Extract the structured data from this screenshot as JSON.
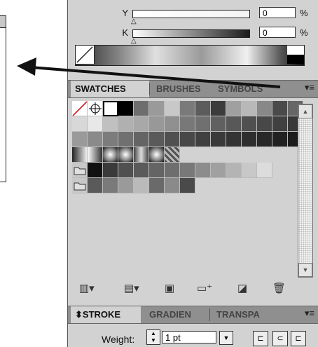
{
  "color_panel": {
    "y_label": "Y",
    "y_value": "0",
    "k_label": "K",
    "k_value": "0",
    "unit": "%"
  },
  "swatches_panel": {
    "tabs": [
      "SWATCHES",
      "BRUSHES",
      "SYMBOLS"
    ],
    "menu_icon": "panel-menu-icon"
  },
  "stroke_panel": {
    "tabs": [
      "STROKE",
      "GRADIEN",
      "TRANSPA"
    ],
    "stroke_prefix": "⬍",
    "weight_label": "Weight:",
    "weight_value": "1 pt"
  },
  "swatch_rows": [
    [
      "none",
      "registration",
      "white",
      "#000000",
      "#6e6e6e",
      "#9a9a9a",
      "#c8c8c8",
      "#7a7a7a",
      "#5c5c5c",
      "#3c3c3c",
      "#a0a0a0",
      "#b8b8b8",
      "#888888",
      "#4a4a4a",
      "#666666"
    ],
    [
      "#d8d8d8",
      "#e8e8e8",
      "#c0c0c0",
      "#b0b0b0",
      "#a8a8a8",
      "#989898",
      "#909090",
      "#787878",
      "#707070",
      "#606060",
      "#585858",
      "#505050",
      "#484848",
      "#404040",
      "#383838"
    ],
    [
      "#9a9a9a",
      "#8a8a8a",
      "#7c7c7c",
      "#707070",
      "#646464",
      "#5a5a5a",
      "#505050",
      "#484848",
      "#404040",
      "#3a3a3a",
      "#343434",
      "#2e2e2e",
      "#282828",
      "#222222",
      "#1c1c1c"
    ],
    [
      "grad-a",
      "grad-b",
      "radial",
      "radial",
      "grad-c",
      "radial",
      "pattern"
    ],
    [
      "folder",
      "#111111",
      "#3a3a3a",
      "#505050",
      "#5a5a5a",
      "#646464",
      "#6e6e6e",
      "#787878",
      "#8c8c8c",
      "#a0a0a0",
      "#b4b4b4",
      "#c8c8c8",
      "#dcdcdc"
    ],
    [
      "folder",
      "#5a5a5a",
      "#7a7a7a",
      "#9a9a9a",
      "#bababa",
      "#6a6a6a",
      "#8a8a8a",
      "#4a4a4a"
    ]
  ]
}
